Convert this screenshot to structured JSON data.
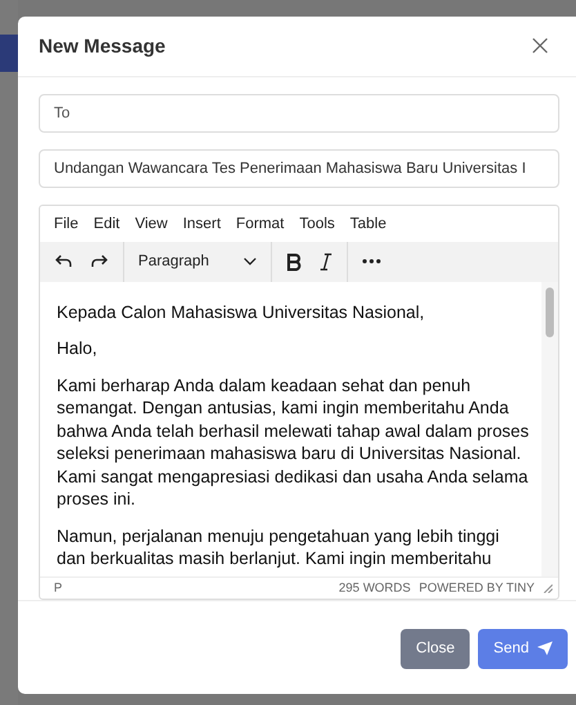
{
  "dialog": {
    "title": "New Message"
  },
  "to": {
    "placeholder": "To"
  },
  "subject": {
    "value": "Undangan Wawancara Tes Penerimaan Mahasiswa Baru Universitas I"
  },
  "editor": {
    "menu": [
      "File",
      "Edit",
      "View",
      "Insert",
      "Format",
      "Tools",
      "Table"
    ],
    "block_format": "Paragraph",
    "paragraphs": [
      "Kepada Calon Mahasiswa Universitas Nasional,",
      "Halo,",
      "Kami berharap Anda dalam keadaan sehat dan penuh semangat. Dengan antusias, kami ingin memberitahu Anda bahwa Anda telah berhasil melewati tahap awal dalam proses seleksi penerimaan mahasiswa baru di Universitas Nasional. Kami sangat mengapresiasi dedikasi dan usaha Anda selama proses ini.",
      "Namun, perjalanan menuju pengetahuan yang lebih tinggi dan berkualitas masih berlanjut. Kami ingin memberitahu"
    ],
    "path": "P",
    "word_count": "295 WORDS",
    "branding": "POWERED BY TINY"
  },
  "buttons": [
    {
      "label": "Close",
      "kind": "secondary"
    },
    {
      "label": "Send",
      "kind": "primary"
    }
  ]
}
